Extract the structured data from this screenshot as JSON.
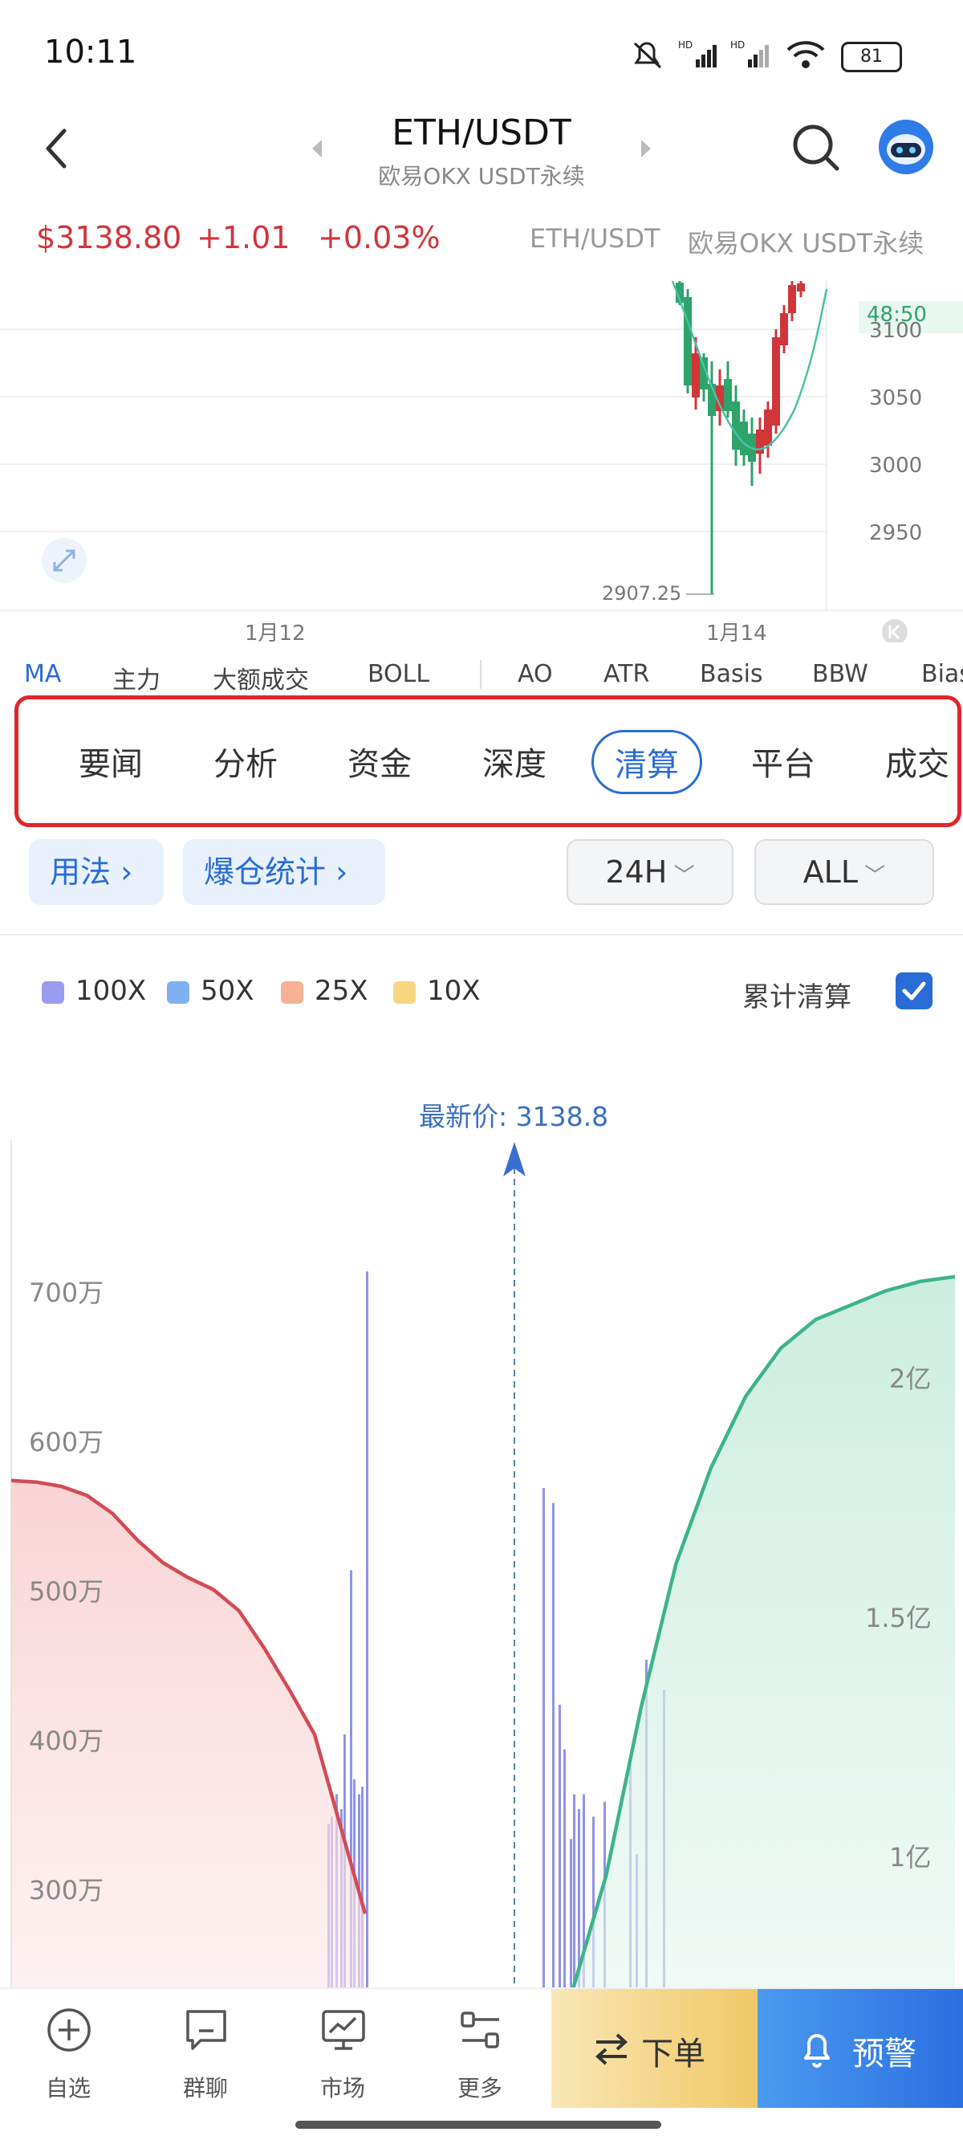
{
  "status_bar": {
    "time": "10:11",
    "battery": "81",
    "signal1": "HD",
    "signal2": "HD",
    "wifi": "6"
  },
  "nav": {
    "title": "ETH/USDT",
    "subtitle": "欧易OKX USDT永续"
  },
  "price": {
    "last": "$3138.80",
    "change": "+1.01",
    "change_pct": "+0.03%",
    "pair": "ETH/USDT",
    "exchange": "欧易OKX USDT永续"
  },
  "kline": {
    "y_ticks": [
      "3100",
      "3050",
      "3000",
      "2950"
    ],
    "current_tag": "48:50",
    "low_label": "2907.25",
    "x_ticks": [
      "1月12",
      "1月14"
    ]
  },
  "indicators": [
    "MA",
    "主力",
    "大额成交",
    "BOLL",
    "AO",
    "ATR",
    "Basis",
    "BBW",
    "Bias"
  ],
  "sections": {
    "items": [
      "要闻",
      "分析",
      "资金",
      "深度",
      "清算",
      "平台",
      "成交"
    ],
    "active": "清算"
  },
  "filters": {
    "usage": "用法",
    "stats": "爆仓统计",
    "period": "24H",
    "scope": "ALL"
  },
  "legend": {
    "items": [
      {
        "label": "100X",
        "color": "#9a9cf0"
      },
      {
        "label": "50X",
        "color": "#7fb0f2"
      },
      {
        "label": "25X",
        "color": "#f6b195"
      },
      {
        "label": "10X",
        "color": "#f8d57e"
      }
    ],
    "cumulative_label": "累计清算",
    "cumulative_checked": true
  },
  "chart_data": {
    "type": "bar",
    "latest_price_label": "最新价: 3138.8",
    "latest_price": 3138.8,
    "y_left_ticks": [
      "700万",
      "600万",
      "500万",
      "400万",
      "300万"
    ],
    "y_right_ticks": [
      "2亿",
      "1.5亿",
      "1亿"
    ],
    "series": [
      {
        "name": "100X",
        "type": "bar",
        "values_wan": [
          710,
          510,
          400,
          360,
          345,
          370,
          365,
          360,
          350,
          340,
          565,
          555,
          420,
          390,
          330,
          360,
          350,
          360,
          345,
          355,
          380,
          320,
          450,
          430
        ]
      },
      {
        "type": "cumulative_short",
        "color": "#d0353a",
        "values_wan": [
          570,
          569,
          566,
          560,
          548,
          530,
          515,
          505,
          497,
          483,
          458,
          430,
          400,
          340,
          280
        ]
      },
      {
        "type": "cumulative_long",
        "color": "#3cb489",
        "values_yi": [
          0.7,
          0.95,
          1.3,
          1.6,
          1.8,
          1.95,
          2.05,
          2.11,
          2.14,
          2.17,
          2.19,
          2.2
        ]
      }
    ]
  },
  "bottom_bar": {
    "items": [
      "自选",
      "群聊",
      "市场",
      "更多"
    ],
    "order": "下单",
    "alert": "预警"
  }
}
